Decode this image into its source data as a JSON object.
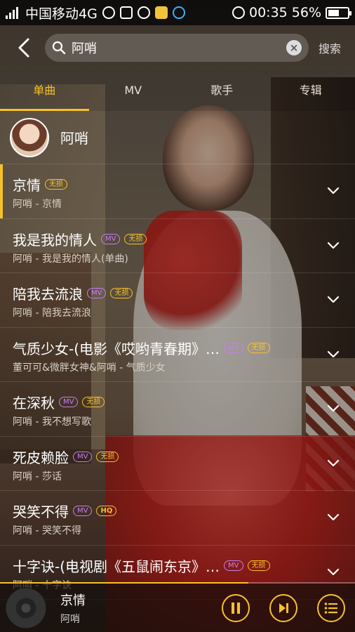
{
  "status_bar": {
    "carrier": "中国移动4G",
    "time": "00:35",
    "battery_percent": "56%",
    "battery_level": 0.56
  },
  "search": {
    "query": "阿哨",
    "button_label": "搜索"
  },
  "tabs": [
    {
      "label": "单曲",
      "active": true
    },
    {
      "label": "MV",
      "active": false
    },
    {
      "label": "歌手",
      "active": false
    },
    {
      "label": "专辑",
      "active": false
    }
  ],
  "artist": {
    "name": "阿哨"
  },
  "songs": [
    {
      "title": "京情",
      "subtitle": "阿哨 - 京情",
      "badges": [
        "无损"
      ],
      "current": true
    },
    {
      "title": "我是我的情人",
      "subtitle": "阿哨 - 我是我的情人(单曲)",
      "badges": [
        "MV",
        "无损"
      ]
    },
    {
      "title": "陪我去流浪",
      "subtitle": "阿哨 - 陪我去流浪",
      "badges": [
        "MV",
        "无损"
      ]
    },
    {
      "title": "气质少女-(电影《哎哟青春期》…",
      "subtitle": "董可可&微胖女神&阿哨 - 气质少女",
      "badges": [
        "MV",
        "无损"
      ]
    },
    {
      "title": "在深秋",
      "subtitle": "阿哨 - 我不想写歌",
      "badges": [
        "MV",
        "无损"
      ]
    },
    {
      "title": "死皮赖脸",
      "subtitle": "阿哨 - 莎话",
      "badges": [
        "MV",
        "无损"
      ]
    },
    {
      "title": "哭笑不得",
      "subtitle": "阿哨 - 哭笑不得",
      "badges": [
        "MV",
        "HQ"
      ]
    },
    {
      "title": "十字诀-(电视剧《五鼠闹东京》…",
      "subtitle": "阿哨 - 十字诀",
      "badges": [
        "MV",
        "无损"
      ]
    }
  ],
  "now_playing": {
    "title": "京情",
    "artist": "阿哨",
    "progress": 0.7
  },
  "colors": {
    "accent": "#f6c22a",
    "mv_badge": "#c77ef2"
  }
}
